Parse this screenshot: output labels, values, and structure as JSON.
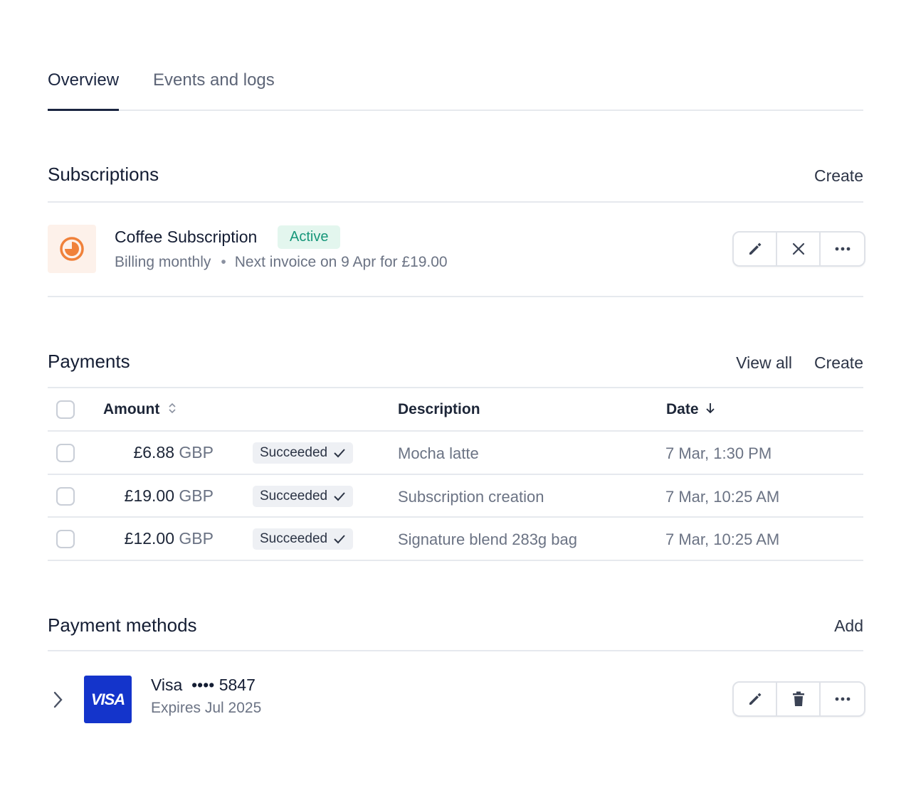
{
  "tabs": {
    "overview": "Overview",
    "events": "Events and logs"
  },
  "subscriptions": {
    "title": "Subscriptions",
    "create": "Create",
    "item": {
      "name": "Coffee Subscription",
      "status": "Active",
      "billing": "Billing monthly",
      "separator": "•",
      "next_invoice": "Next invoice on 9 Apr for £19.00"
    }
  },
  "payments": {
    "title": "Payments",
    "view_all": "View all",
    "create": "Create",
    "columns": {
      "amount": "Amount",
      "description": "Description",
      "date": "Date"
    },
    "rows": [
      {
        "amount": "£6.88",
        "currency": "GBP",
        "status": "Succeeded",
        "description": "Mocha latte",
        "date": "7 Mar, 1:30 PM"
      },
      {
        "amount": "£19.00",
        "currency": "GBP",
        "status": "Succeeded",
        "description": "Subscription creation",
        "date": "7 Mar, 10:25 AM"
      },
      {
        "amount": "£12.00",
        "currency": "GBP",
        "status": "Succeeded",
        "description": "Signature blend 283g bag",
        "date": "7 Mar, 10:25 AM"
      }
    ]
  },
  "payment_methods": {
    "title": "Payment methods",
    "add": "Add",
    "card": {
      "brand_logo": "VISA",
      "name": "Visa",
      "masked": "•••• 5847",
      "expires": "Expires Jul 2025"
    }
  },
  "colors": {
    "accent_orange": "#f0813a",
    "active_green": "#17977a",
    "visa_blue": "#1434cb"
  },
  "icons": [
    "pencil-icon",
    "close-icon",
    "more-icon",
    "trash-icon",
    "sort-icon",
    "arrow-down-icon",
    "check-icon",
    "chevron-right-icon",
    "subscription-clock-icon"
  ]
}
